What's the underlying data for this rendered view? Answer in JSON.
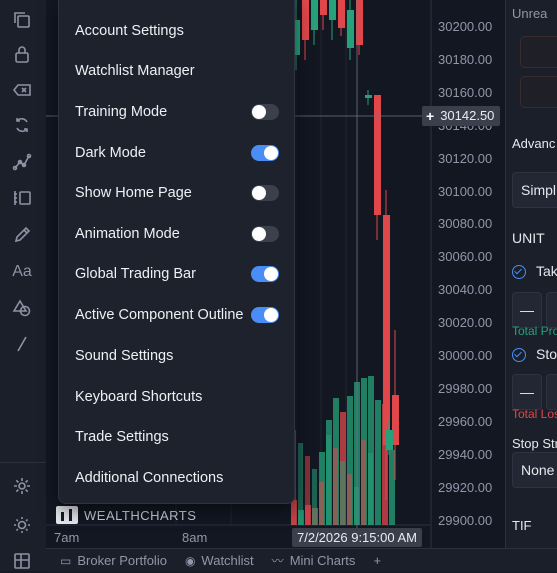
{
  "toolbar": {
    "tools": [
      {
        "name": "copy-icon"
      },
      {
        "name": "lock-icon"
      },
      {
        "name": "erase-icon"
      },
      {
        "name": "sync-icon"
      },
      {
        "name": "trend-line-icon"
      },
      {
        "name": "measure-icon"
      },
      {
        "name": "pencil-icon"
      },
      {
        "name": "text-icon",
        "glyph": "Aa"
      },
      {
        "name": "shapes-icon"
      },
      {
        "name": "line-icon"
      }
    ],
    "bottom_tools": [
      {
        "name": "settings-gear-icon"
      },
      {
        "name": "sun-icon"
      },
      {
        "name": "layout-grid-icon"
      }
    ]
  },
  "menu": {
    "items": [
      {
        "label": "Account Settings"
      },
      {
        "label": "Watchlist Manager"
      },
      {
        "label": "Training Mode",
        "toggle": false
      },
      {
        "label": "Dark Mode",
        "toggle": true
      },
      {
        "label": "Show Home Page",
        "toggle": false
      },
      {
        "label": "Animation Mode",
        "toggle": false
      },
      {
        "label": "Global Trading Bar",
        "toggle": true
      },
      {
        "label": "Active Component Outline",
        "toggle": true
      },
      {
        "label": "Sound Settings"
      },
      {
        "label": "Keyboard Shortcuts"
      },
      {
        "label": "Trade Settings"
      },
      {
        "label": "Additional Connections"
      }
    ]
  },
  "chart": {
    "price_axis": [
      "30200.00",
      "30180.00",
      "30160.00",
      "30140.00",
      "30120.00",
      "30100.00",
      "30080.00",
      "30060.00",
      "30040.00",
      "30020.00",
      "30000.00",
      "29980.00",
      "29960.00",
      "29940.00",
      "29920.00",
      "29900.00"
    ],
    "current_price": "30142.50",
    "time_axis": [
      "7am",
      "8am"
    ],
    "crosshair_time": "7/2/2026 9:15:00 AM",
    "watermark": "WEALTHCHARTS",
    "colors": {
      "up": "#26a17a",
      "down": "#e0474b",
      "background": "#131722"
    }
  },
  "bottom_bar": {
    "tabs": [
      {
        "label": "Broker Portfolio",
        "icon": "briefcase-icon"
      },
      {
        "label": "Watchlist",
        "icon": "eye-icon"
      },
      {
        "label": "Mini Charts",
        "icon": "mini-chart-icon"
      }
    ],
    "add_symbol": "+"
  },
  "side_panel": {
    "unrealized": "Unrea",
    "advanced": "Advanc",
    "order_type": "Simpl",
    "unit": "UNIT",
    "take_profit": "Tak",
    "minus": "—",
    "total_profit": "Total Pro",
    "stop_loss": "Sto",
    "total_loss": "Total Los",
    "stop_strategy": "Stop Str",
    "stop_strategy_value": "None",
    "tif": "TIF"
  }
}
